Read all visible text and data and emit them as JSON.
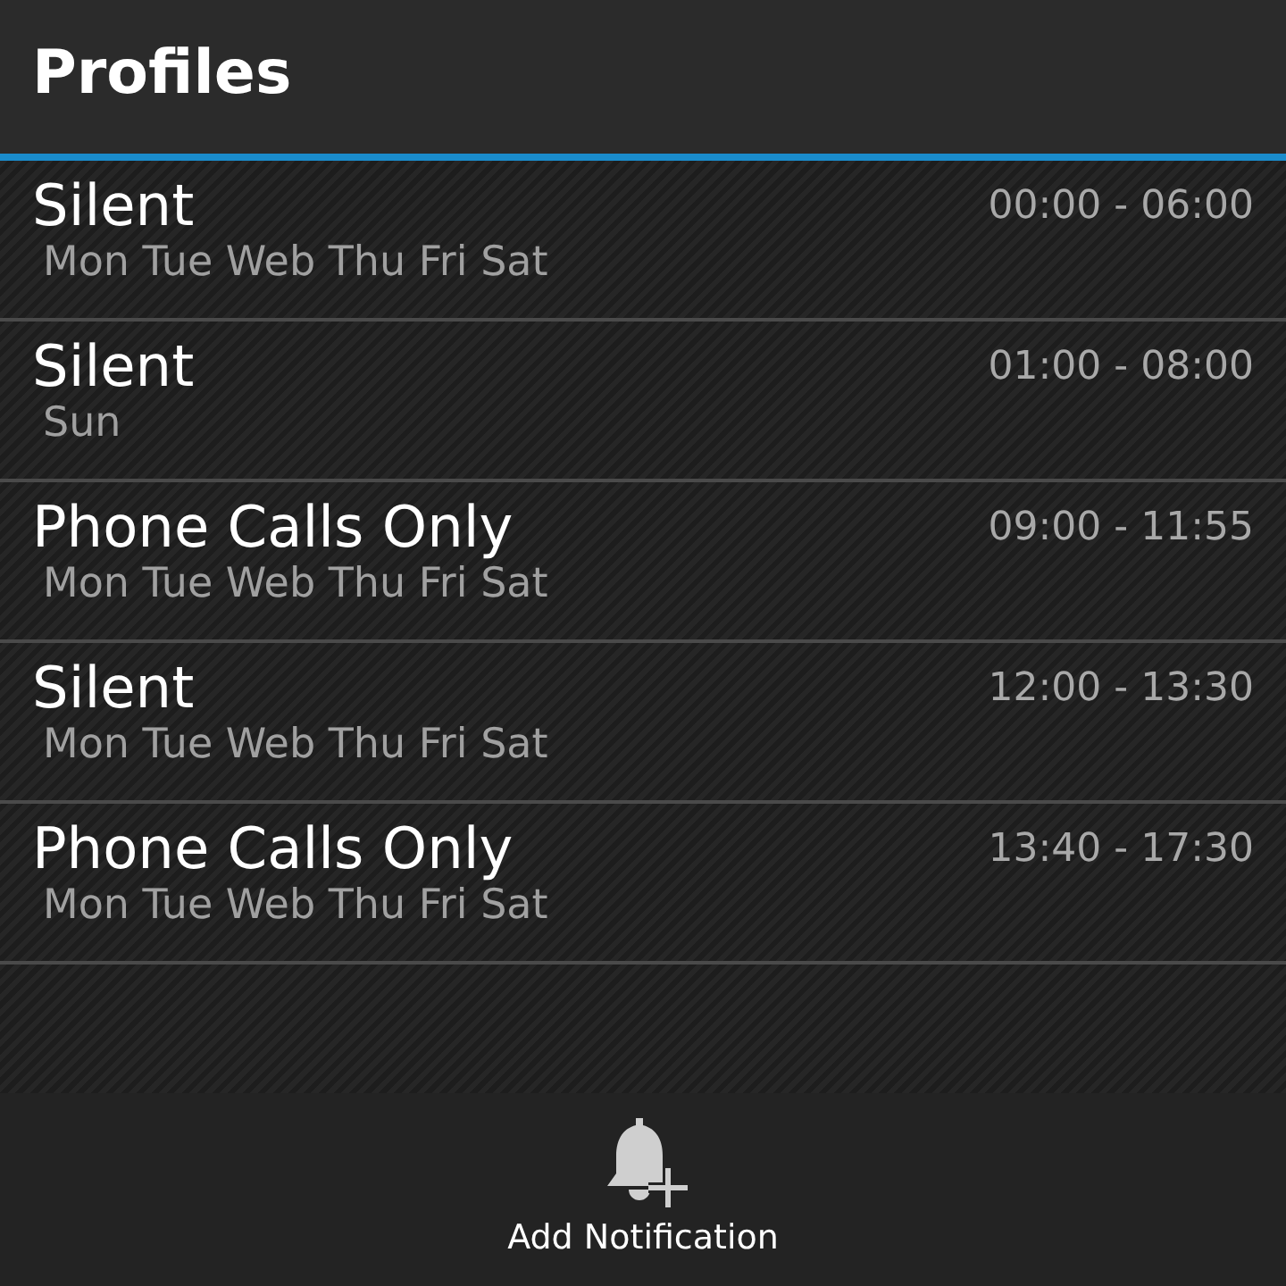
{
  "title": "Profiles",
  "profiles": [
    {
      "name": "Silent",
      "days": "Mon Tue Web Thu Fri Sat",
      "time": "00:00 - 06:00"
    },
    {
      "name": "Silent",
      "days": "Sun",
      "time": "01:00 - 08:00"
    },
    {
      "name": "Phone Calls Only",
      "days": "Mon Tue Web Thu Fri Sat",
      "time": "09:00 - 11:55"
    },
    {
      "name": "Silent",
      "days": "Mon Tue Web Thu Fri Sat",
      "time": "12:00 - 13:30"
    },
    {
      "name": "Phone Calls Only",
      "days": "Mon Tue Web Thu Fri Sat",
      "time": "13:40 - 17:30"
    }
  ],
  "action": {
    "label": "Add Notification"
  }
}
